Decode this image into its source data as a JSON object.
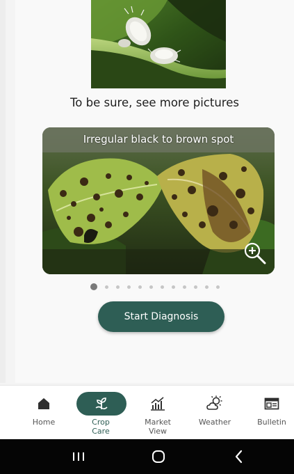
{
  "instructions": {
    "caption": "To be sure, see more pictures"
  },
  "carousel": {
    "slide_title": "Irregular black to brown spot",
    "dot_count": 12,
    "active_index": 0
  },
  "actions": {
    "start_label": "Start Diagnosis"
  },
  "nav": {
    "items": [
      {
        "label": "Home",
        "icon": "home-icon",
        "active": false
      },
      {
        "label": "Crop\nCare",
        "icon": "sprout-icon",
        "active": true
      },
      {
        "label": "Market\nView",
        "icon": "chart-icon",
        "active": false
      },
      {
        "label": "Weather",
        "icon": "weather-icon",
        "active": false
      },
      {
        "label": "Bulletin",
        "icon": "newspaper-icon",
        "active": false
      }
    ]
  },
  "colors": {
    "primary": "#2e5e55",
    "background": "#f9f9f9"
  }
}
